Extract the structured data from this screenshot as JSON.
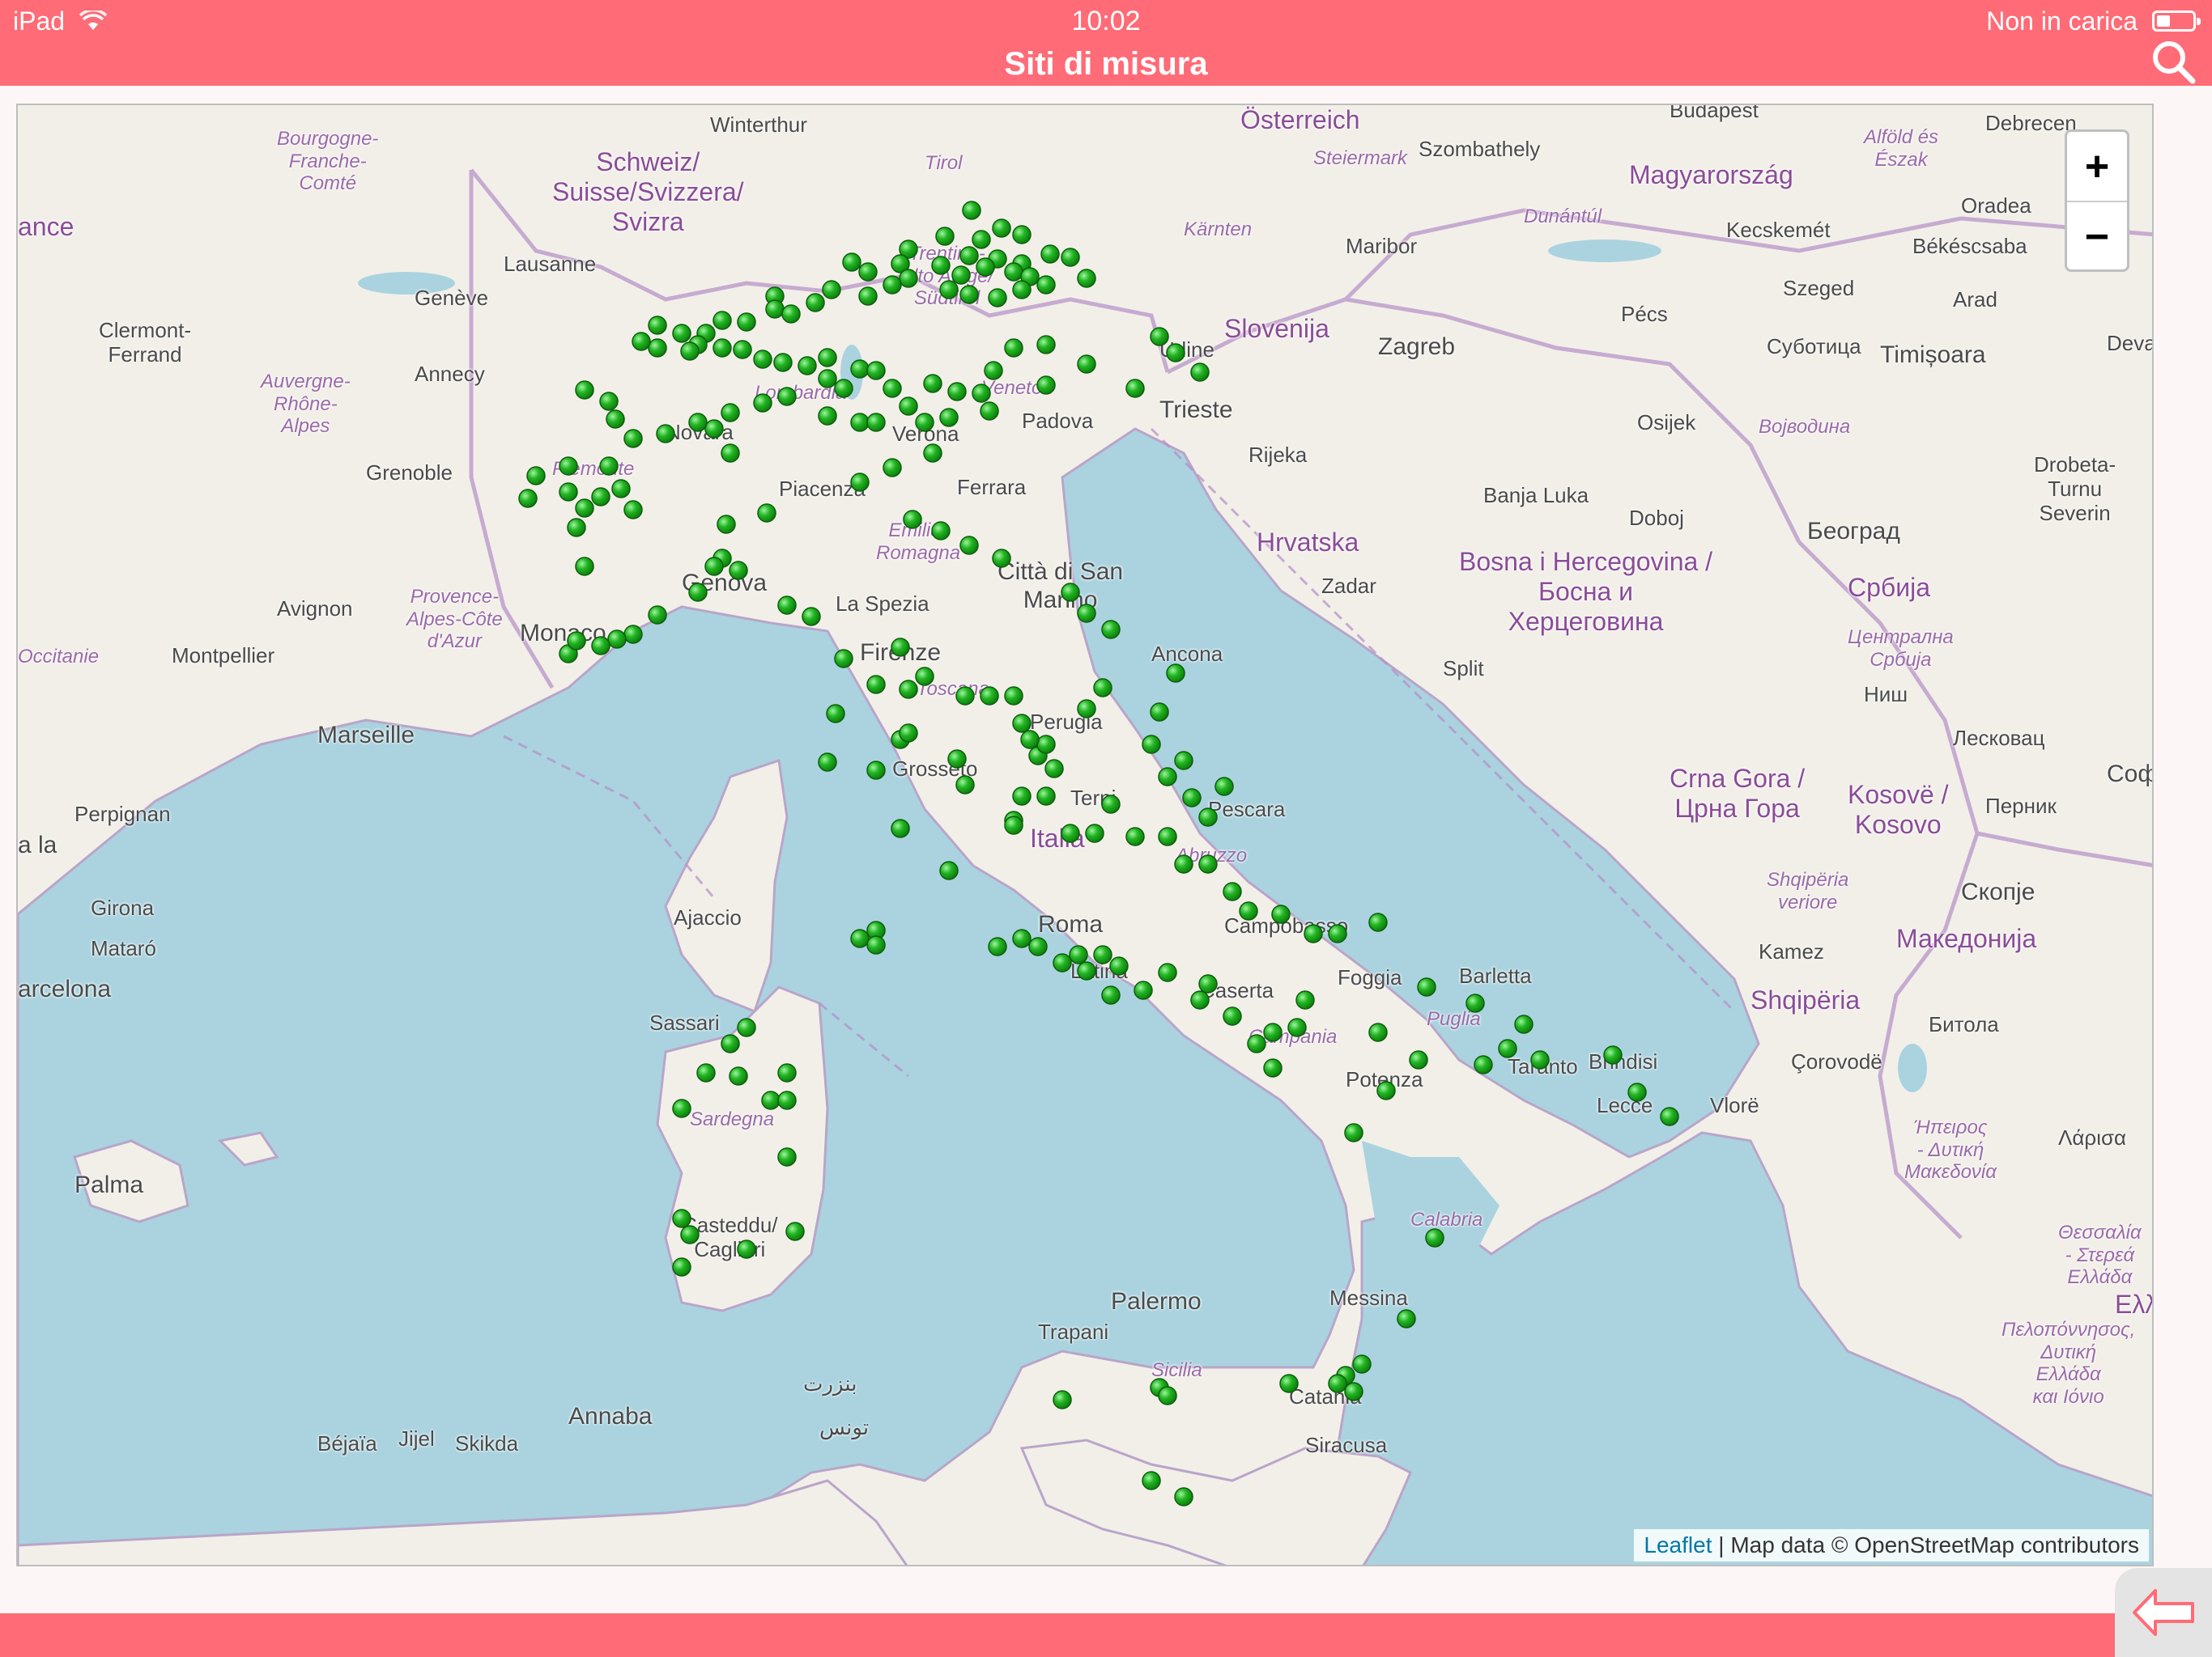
{
  "status_bar": {
    "device": "iPad",
    "time": "10:02",
    "battery_text": "Non in carica",
    "battery_level": 0.3
  },
  "header": {
    "title": "Siti di misura",
    "search_icon": "search-icon"
  },
  "map": {
    "zoom_in_label": "+",
    "zoom_out_label": "−",
    "attribution_link": "Leaflet",
    "attribution_text": "| Map data © OpenStreetMap contributors",
    "marker_color": "#22b422",
    "labels": {
      "winterthur": "Winterthur",
      "osterreich": "Österreich",
      "budapest": "Budapest",
      "debrecen": "Debrecen",
      "bourgogne": "Bourgogne-\nFranche-\nComté",
      "schweiz": "Schweiz/\nSuisse/Svizzera/\nSvizra",
      "tirol": "Tirol",
      "steiermark": "Steiermark",
      "szombathely": "Szombathely",
      "magyarorszag": "Magyarország",
      "alfold": "Alföld és\nÉszak",
      "oradea": "Oradea",
      "france_part": "ance",
      "lausanne": "Lausanne",
      "geneve": "Genève",
      "karnten": "Kärnten",
      "maribor": "Maribor",
      "dunantul": "Dunántúl",
      "kecskemet": "Kecskemét",
      "bekescsaba": "Békéscsaba",
      "clermont": "Clermont-\nFerrand",
      "annecy": "Annecy",
      "trentino": "Trentino-\nAlto Adige/\nSüdtirol",
      "udine": "Udine",
      "slovenija": "Slovenija",
      "zagreb": "Zagreb",
      "pecs": "Pécs",
      "szeged": "Szeged",
      "arad": "Arad",
      "deva": "Deva",
      "auvergne": "Auvergne-\nRhône-\nAlpes",
      "lombardia": "Lombardia",
      "veneto": "Veneto",
      "trieste": "Trieste",
      "subotica": "Суботица",
      "timisoara": "Timișoara",
      "grenoble": "Grenoble",
      "novara": "Novara",
      "verona": "Verona",
      "padova": "Padova",
      "rijeka": "Rijeka",
      "osijek": "Osijek",
      "vojvodina": "Војводина",
      "piemonte": "Piemonte",
      "piacenza": "Piacenza",
      "ferrara": "Ferrara",
      "banja_luka": "Banja Luka",
      "doboj": "Doboj",
      "beograd": "Београд",
      "drobeta": "Drobeta-\nTurnu\nSeverin",
      "avignon": "Avignon",
      "provence": "Provence-\nAlpes-Côte\nd'Azur",
      "genova": "Genova",
      "emilia": "Emilia-\nRomagna",
      "san_marino": "Città di San\nMarino",
      "hrvatska": "Hrvatska",
      "zadar": "Zadar",
      "bosna": "Bosna i Hercegovina /\nБосна и\nХерцеговина",
      "srbija": "Србија",
      "monaco": "Monaco",
      "la_spezia": "La Spezia",
      "occitanie": "Occitanie",
      "montpellier": "Montpellier",
      "firenze": "Firenze",
      "ancona": "Ancona",
      "split": "Split",
      "centralna": "Централна\nСрбија",
      "marseille": "Marseille",
      "toscana": "Toscana",
      "perugia": "Perugia",
      "nis": "Ниш",
      "leskovac": "Лесковац",
      "grosseto": "Grosseto",
      "terni": "Terni",
      "pescara": "Pescara",
      "crna_gora": "Crna Gora /\nЦрна Гора",
      "kosovo": "Kosovë /\nKosovo",
      "sofia": "Соф",
      "perpignan": "Perpignan",
      "pernik": "Перник",
      "italia": "Italia",
      "abruzzo": "Abruzzo",
      "la_la": "a la",
      "shqiperia_veriore": "Shqipëria\nveriore",
      "skopje": "Скопје",
      "girona": "Girona",
      "ajaccio": "Ajaccio",
      "roma": "Roma",
      "campobasso": "Campobasso",
      "makedonija": "Македонија",
      "mataro": "Mataró",
      "latina": "Latina",
      "foggia": "Foggia",
      "barletta": "Barletta",
      "kamez": "Kamez",
      "barcelona": "arcelona",
      "caserta": "Caserta",
      "shqiperia": "Shqipëria",
      "sassari": "Sassari",
      "puglia": "Puglia",
      "bitola": "Битола",
      "campania": "Campania",
      "brindisi": "Brindisi",
      "potenza": "Potenza",
      "taranto": "Taranto",
      "corovode": "Çorovodë",
      "vlore": "Vlorë",
      "sardegna": "Sardegna",
      "lecce": "Lecce",
      "ipeiros": "Ήπειρος\n- Δυτική\nΜακεδονία",
      "larisa": "Λάρισα",
      "palma": "Palma",
      "calabria": "Calabria",
      "thessalia": "Θεσσαλία\n- Στερεά\nΕλλάδα",
      "casteddu": "Casteddu/\nCagliari",
      "ellada": "Ελλά",
      "palermo": "Palermo",
      "messina": "Messina",
      "trapani": "Trapani",
      "peloponnisos": "Πελοπόννησος,\nΔυτική\nΕλλάδα\nκαι Ιόνιο",
      "sicilia": "Sicilia",
      "catania": "Catania",
      "annaba": "Annaba",
      "bizerte": "بنزرت",
      "tunis": "تونس",
      "bejaia": "Béjaïa",
      "jijel": "Jijel",
      "skikda": "Skikda",
      "siracusa": "Siracusa"
    }
  },
  "footer": {
    "back_icon": "back-arrow-icon"
  }
}
